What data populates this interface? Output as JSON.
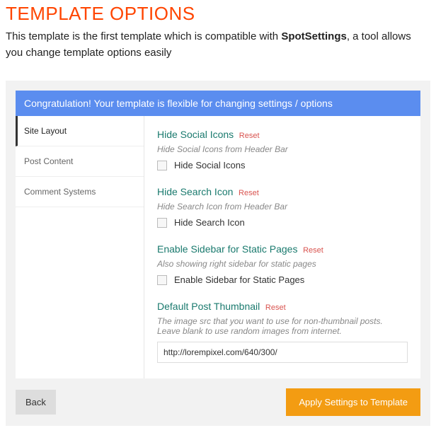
{
  "header": {
    "title": "TEMPLATE OPTIONS",
    "intro_a": "This template is the first template which is compatible with ",
    "intro_bold": "SpotSettings",
    "intro_b": ", a tool allows you change template options easily"
  },
  "banner": "Congratulation! Your template is flexible for changing settings / options",
  "sidebar": {
    "items": [
      {
        "label": "Site Layout"
      },
      {
        "label": "Post Content"
      },
      {
        "label": "Comment Systems"
      }
    ]
  },
  "reset_label": "Reset",
  "sections": {
    "hide_social": {
      "title": "Hide Social Icons",
      "desc": "Hide Social Icons from Header Bar",
      "checkbox_label": "Hide Social Icons"
    },
    "hide_search": {
      "title": "Hide Search Icon",
      "desc": "Hide Search Icon from Header Bar",
      "checkbox_label": "Hide Search Icon"
    },
    "enable_sidebar": {
      "title": "Enable Sidebar for Static Pages",
      "desc": "Also showing right sidebar for static pages",
      "checkbox_label": "Enable Sidebar for Static Pages"
    },
    "default_thumb": {
      "title": "Default Post Thumbnail",
      "desc": "The image src that you want to use for non-thumbnail posts. Leave blank to use random images from internet.",
      "value": "http://lorempixel.com/640/300/"
    }
  },
  "footer": {
    "back": "Back",
    "apply": "Apply Settings to Template"
  }
}
